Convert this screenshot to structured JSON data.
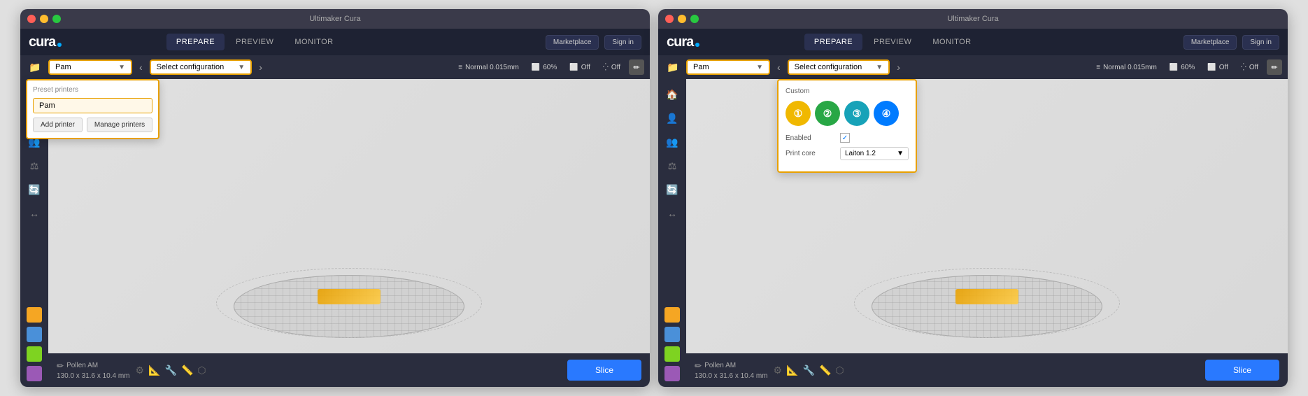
{
  "app": {
    "title": "Ultimaker Cura"
  },
  "left_window": {
    "title_bar": {
      "title": "Ultimaker Cura"
    },
    "header": {
      "logo": "cura",
      "tabs": [
        {
          "label": "PREPARE",
          "active": true
        },
        {
          "label": "PREVIEW",
          "active": false
        },
        {
          "label": "MONITOR",
          "active": false
        }
      ],
      "marketplace_btn": "Marketplace",
      "signin_btn": "Sign in"
    },
    "toolbar": {
      "printer_name": "Pam",
      "config_label": "Select configuration",
      "normal_quality": "Normal 0.015mm",
      "infill_pct": "60%",
      "support_label": "Off",
      "adhesion_label": "Off"
    },
    "dropdown": {
      "section_label": "Preset printers",
      "printer_item": "Pam",
      "add_btn": "Add printer",
      "manage_btn": "Manage printers"
    },
    "bottom": {
      "info_line1": "Pollen AM",
      "info_line2": "130.0 x 31.6 x 10.4 mm",
      "slice_btn": "Slice"
    }
  },
  "right_window": {
    "title_bar": {
      "title": "Ultimaker Cura"
    },
    "header": {
      "logo": "cura",
      "tabs": [
        {
          "label": "PREPARE",
          "active": true
        },
        {
          "label": "PREVIEW",
          "active": false
        },
        {
          "label": "MONITOR",
          "active": false
        }
      ],
      "marketplace_btn": "Marketplace",
      "signin_btn": "Sign in"
    },
    "toolbar": {
      "printer_name": "Pam",
      "config_label": "Select configuration",
      "normal_quality": "Normal 0.015mm",
      "infill_pct": "60%",
      "support_label": "Off",
      "adhesion_label": "Off"
    },
    "config_dropdown": {
      "section_label": "Custom",
      "extruders": [
        {
          "color": "yellow",
          "symbol": "①"
        },
        {
          "color": "green",
          "symbol": "②"
        },
        {
          "color": "blue-light",
          "symbol": "③"
        },
        {
          "color": "blue",
          "symbol": "④"
        }
      ],
      "enabled_label": "Enabled",
      "enabled_checked": true,
      "print_core_label": "Print core",
      "print_core_value": "Laiton 1.2"
    },
    "bottom": {
      "info_line1": "Pollen AM",
      "info_line2": "130.0 x 31.6 x 10.4 mm",
      "slice_btn": "Slice"
    }
  },
  "sidebar_icons": [
    "🗂",
    "👤",
    "👥",
    "🔧",
    "📋",
    "🎨",
    "🟧",
    "🟦"
  ],
  "colors": {
    "header_bg": "#1e2233",
    "toolbar_bg": "#2a2d3e",
    "sidebar_bg": "#2a2d3e",
    "accent_orange": "#e8a000",
    "slice_blue": "#2979ff",
    "viewport_bg": "#e8e8e8"
  }
}
